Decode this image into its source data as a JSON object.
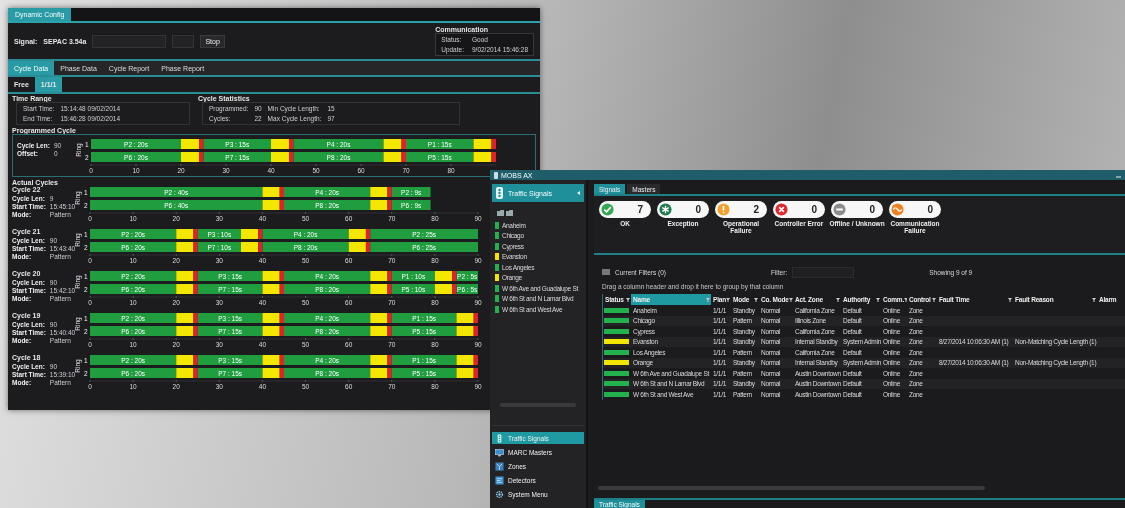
{
  "config_window": {
    "title": "Dynamic Config",
    "signal_label": "Signal:",
    "signal_value": "SEPAC 3.54a",
    "stop_button": "Stop",
    "communication": {
      "title": "Communication",
      "rows": [
        {
          "label": "Status:",
          "value": "Good"
        },
        {
          "label": "Update:",
          "value": "9/02/2014 15:46:28"
        }
      ]
    },
    "tabs": [
      {
        "label": "Cycle Data",
        "selected": true
      },
      {
        "label": "Phase Data",
        "selected": false
      },
      {
        "label": "Cycle Report",
        "selected": false
      },
      {
        "label": "Phase Report",
        "selected": false
      }
    ],
    "sub_tabs": [
      {
        "label": "Free",
        "selected": false
      },
      {
        "label": "1/1/1",
        "selected": true
      }
    ],
    "time_range": {
      "title": "Time Range",
      "rows": [
        {
          "label": "Start Time:",
          "value": "15:14:48 09/02/2014"
        },
        {
          "label": "End Time:",
          "value": "15:46:28 09/02/2014"
        }
      ]
    },
    "cycle_statistics": {
      "title": "Cycle Statistics",
      "items": [
        {
          "label": "Programmed:",
          "value": "90"
        },
        {
          "label": "Min Cycle Length:",
          "value": "15"
        },
        {
          "label": "Cycles:",
          "value": "22"
        },
        {
          "label": "Max Cycle Length:",
          "value": "97"
        }
      ]
    },
    "programmed_cycle": {
      "title": "Programmed Cycle",
      "fields": [
        {
          "label": "Cycle Len:",
          "value": "90"
        },
        {
          "label": "Offset:",
          "value": "0"
        }
      ],
      "chart_data": {
        "type": "bar",
        "orientation": "horizontal",
        "stacked": true,
        "ylabel": "Ring",
        "categories": [
          "1",
          "2"
        ],
        "xlim": [
          0,
          90
        ],
        "xticks": [
          0,
          10,
          20,
          30,
          40,
          50,
          60,
          70,
          80
        ],
        "series": [
          {
            "color": "#1f9d3f",
            "values": [
              20,
              20
            ],
            "value_labels": [
              "P2 : 20s",
              "P6 : 20s"
            ]
          },
          {
            "color": "#f3e600",
            "values": [
              4,
              4
            ]
          },
          {
            "color": "#e3202b",
            "values": [
              1,
              1
            ]
          },
          {
            "color": "#1f9d3f",
            "values": [
              15,
              15
            ],
            "value_labels": [
              "P3 : 15s",
              "P7 : 15s"
            ]
          },
          {
            "color": "#f3e600",
            "values": [
              4,
              4
            ]
          },
          {
            "color": "#e3202b",
            "values": [
              1,
              1
            ]
          },
          {
            "color": "#1f9d3f",
            "values": [
              20,
              20
            ],
            "value_labels": [
              "P4 : 20s",
              "P8 : 20s"
            ]
          },
          {
            "color": "#f3e600",
            "values": [
              4,
              4
            ]
          },
          {
            "color": "#e3202b",
            "values": [
              1,
              1
            ]
          },
          {
            "color": "#1f9d3f",
            "values": [
              15,
              15
            ],
            "value_labels": [
              "P1 : 15s",
              "P5 : 15s"
            ]
          },
          {
            "color": "#f3e600",
            "values": [
              4,
              4
            ]
          },
          {
            "color": "#e3202b",
            "values": [
              1,
              1
            ]
          }
        ]
      }
    },
    "actual_cycles": {
      "title": "Actual Cycles",
      "cycles": [
        {
          "title": "Cycle 22",
          "fields": [
            {
              "label": "Cycle Len:",
              "value": "9"
            },
            {
              "label": "Start Time:",
              "value": "15:45:10"
            },
            {
              "label": "Mode:",
              "value": "Pattern"
            }
          ],
          "chart_data": {
            "type": "bar",
            "orientation": "horizontal",
            "stacked": true,
            "ylabel": "Ring",
            "categories": [
              "1",
              "2"
            ],
            "xlim": [
              0,
              90
            ],
            "xticks": [
              0,
              10,
              20,
              30,
              40,
              50,
              60,
              70,
              80,
              90
            ],
            "series": [
              {
                "color": "#1f9d3f",
                "values": [
                  40,
                  40
                ],
                "value_labels": [
                  "P2 : 40s",
                  "P6 : 40s"
                ]
              },
              {
                "color": "#f3e600",
                "values": [
                  4,
                  4
                ]
              },
              {
                "color": "#e3202b",
                "values": [
                  1,
                  1
                ]
              },
              {
                "color": "#1f9d3f",
                "values": [
                  20,
                  20
                ],
                "value_labels": [
                  "P4 : 20s",
                  "P8 : 20s"
                ]
              },
              {
                "color": "#f3e600",
                "values": [
                  4,
                  4
                ]
              },
              {
                "color": "#e3202b",
                "values": [
                  1,
                  1
                ]
              },
              {
                "color": "#1f9d3f",
                "values": [
                  9,
                  9
                ],
                "value_labels": [
                  "P2 : 9s",
                  "P6 : 9s"
                ]
              }
            ]
          }
        },
        {
          "title": "Cycle 21",
          "fields": [
            {
              "label": "Cycle Len:",
              "value": "90"
            },
            {
              "label": "Start Time:",
              "value": "15:43:40"
            },
            {
              "label": "Mode:",
              "value": "Pattern"
            }
          ],
          "chart_data": {
            "type": "bar",
            "orientation": "horizontal",
            "stacked": true,
            "ylabel": "Ring",
            "categories": [
              "1",
              "2"
            ],
            "xlim": [
              0,
              90
            ],
            "xticks": [
              0,
              10,
              20,
              30,
              40,
              50,
              60,
              70,
              80,
              90
            ],
            "series": [
              {
                "color": "#1f9d3f",
                "values": [
                  20,
                  20
                ],
                "value_labels": [
                  "P2 : 20s",
                  "P6 : 20s"
                ]
              },
              {
                "color": "#f3e600",
                "values": [
                  4,
                  4
                ]
              },
              {
                "color": "#e3202b",
                "values": [
                  1,
                  1
                ]
              },
              {
                "color": "#1f9d3f",
                "values": [
                  10,
                  10
                ],
                "value_labels": [
                  "P3 : 10s",
                  "P7 : 10s"
                ]
              },
              {
                "color": "#f3e600",
                "values": [
                  4,
                  4
                ]
              },
              {
                "color": "#e3202b",
                "values": [
                  1,
                  1
                ]
              },
              {
                "color": "#1f9d3f",
                "values": [
                  20,
                  20
                ],
                "value_labels": [
                  "P4 : 20s",
                  "P8 : 20s"
                ]
              },
              {
                "color": "#f3e600",
                "values": [
                  4,
                  4
                ]
              },
              {
                "color": "#e3202b",
                "values": [
                  1,
                  1
                ]
              },
              {
                "color": "#1f9d3f",
                "values": [
                  25,
                  25
                ],
                "value_labels": [
                  "P2 : 25s",
                  "P6 : 25s"
                ]
              }
            ]
          }
        },
        {
          "title": "Cycle 20",
          "fields": [
            {
              "label": "Cycle Len:",
              "value": "90"
            },
            {
              "label": "Start Time:",
              "value": "15:42:10"
            },
            {
              "label": "Mode:",
              "value": "Pattern"
            }
          ],
          "chart_data": {
            "type": "bar",
            "orientation": "horizontal",
            "stacked": true,
            "ylabel": "Ring",
            "categories": [
              "1",
              "2"
            ],
            "xlim": [
              0,
              90
            ],
            "xticks": [
              0,
              10,
              20,
              30,
              40,
              50,
              60,
              70,
              80,
              90
            ],
            "series": [
              {
                "color": "#1f9d3f",
                "values": [
                  20,
                  20
                ],
                "value_labels": [
                  "P2 : 20s",
                  "P6 : 20s"
                ]
              },
              {
                "color": "#f3e600",
                "values": [
                  4,
                  4
                ]
              },
              {
                "color": "#e3202b",
                "values": [
                  1,
                  1
                ]
              },
              {
                "color": "#1f9d3f",
                "values": [
                  15,
                  15
                ],
                "value_labels": [
                  "P3 : 15s",
                  "P7 : 15s"
                ]
              },
              {
                "color": "#f3e600",
                "values": [
                  4,
                  4
                ]
              },
              {
                "color": "#e3202b",
                "values": [
                  1,
                  1
                ]
              },
              {
                "color": "#1f9d3f",
                "values": [
                  20,
                  20
                ],
                "value_labels": [
                  "P4 : 20s",
                  "P8 : 20s"
                ]
              },
              {
                "color": "#f3e600",
                "values": [
                  4,
                  4
                ]
              },
              {
                "color": "#e3202b",
                "values": [
                  1,
                  1
                ]
              },
              {
                "color": "#1f9d3f",
                "values": [
                  10,
                  10
                ],
                "value_labels": [
                  "P1 : 10s",
                  "P5 : 10s"
                ]
              },
              {
                "color": "#f3e600",
                "values": [
                  4,
                  4
                ]
              },
              {
                "color": "#e3202b",
                "values": [
                  1,
                  1
                ]
              },
              {
                "color": "#1f9d3f",
                "values": [
                  5,
                  5
                ],
                "value_labels": [
                  "P2 : 5s",
                  "P6 : 5s"
                ]
              }
            ]
          }
        },
        {
          "title": "Cycle 19",
          "fields": [
            {
              "label": "Cycle Len:",
              "value": "90"
            },
            {
              "label": "Start Time:",
              "value": "15:40:40"
            },
            {
              "label": "Mode:",
              "value": "Pattern"
            }
          ],
          "chart_data": {
            "type": "bar",
            "orientation": "horizontal",
            "stacked": true,
            "ylabel": "Ring",
            "categories": [
              "1",
              "2"
            ],
            "xlim": [
              0,
              90
            ],
            "xticks": [
              0,
              10,
              20,
              30,
              40,
              50,
              60,
              70,
              80,
              90
            ],
            "series": [
              {
                "color": "#1f9d3f",
                "values": [
                  20,
                  20
                ],
                "value_labels": [
                  "P2 : 20s",
                  "P6 : 20s"
                ]
              },
              {
                "color": "#f3e600",
                "values": [
                  4,
                  4
                ]
              },
              {
                "color": "#e3202b",
                "values": [
                  1,
                  1
                ]
              },
              {
                "color": "#1f9d3f",
                "values": [
                  15,
                  15
                ],
                "value_labels": [
                  "P3 : 15s",
                  "P7 : 15s"
                ]
              },
              {
                "color": "#f3e600",
                "values": [
                  4,
                  4
                ]
              },
              {
                "color": "#e3202b",
                "values": [
                  1,
                  1
                ]
              },
              {
                "color": "#1f9d3f",
                "values": [
                  20,
                  20
                ],
                "value_labels": [
                  "P4 : 20s",
                  "P8 : 20s"
                ]
              },
              {
                "color": "#f3e600",
                "values": [
                  4,
                  4
                ]
              },
              {
                "color": "#e3202b",
                "values": [
                  1,
                  1
                ]
              },
              {
                "color": "#1f9d3f",
                "values": [
                  15,
                  15
                ],
                "value_labels": [
                  "P1 : 15s",
                  "P5 : 15s"
                ]
              },
              {
                "color": "#f3e600",
                "values": [
                  4,
                  4
                ]
              },
              {
                "color": "#e3202b",
                "values": [
                  1,
                  1
                ]
              }
            ]
          }
        },
        {
          "title": "Cycle 18",
          "fields": [
            {
              "label": "Cycle Len:",
              "value": "90"
            },
            {
              "label": "Start Time:",
              "value": "15:39:10"
            },
            {
              "label": "Mode:",
              "value": "Pattern"
            }
          ],
          "chart_data": {
            "type": "bar",
            "orientation": "horizontal",
            "stacked": true,
            "ylabel": "Ring",
            "categories": [
              "1",
              "2"
            ],
            "xlim": [
              0,
              90
            ],
            "xticks": [
              0,
              10,
              20,
              30,
              40,
              50,
              60,
              70,
              80,
              90
            ],
            "series": [
              {
                "color": "#1f9d3f",
                "values": [
                  20,
                  20
                ],
                "value_labels": [
                  "P2 : 20s",
                  "P6 : 20s"
                ]
              },
              {
                "color": "#f3e600",
                "values": [
                  4,
                  4
                ]
              },
              {
                "color": "#e3202b",
                "values": [
                  1,
                  1
                ]
              },
              {
                "color": "#1f9d3f",
                "values": [
                  15,
                  15
                ],
                "value_labels": [
                  "P3 : 15s",
                  "P7 : 15s"
                ]
              },
              {
                "color": "#f3e600",
                "values": [
                  4,
                  4
                ]
              },
              {
                "color": "#e3202b",
                "values": [
                  1,
                  1
                ]
              },
              {
                "color": "#1f9d3f",
                "values": [
                  20,
                  20
                ],
                "value_labels": [
                  "P4 : 20s",
                  "P8 : 20s"
                ]
              },
              {
                "color": "#f3e600",
                "values": [
                  4,
                  4
                ]
              },
              {
                "color": "#e3202b",
                "values": [
                  1,
                  1
                ]
              },
              {
                "color": "#1f9d3f",
                "values": [
                  15,
                  15
                ],
                "value_labels": [
                  "P1 : 15s",
                  "P5 : 15s"
                ]
              },
              {
                "color": "#f3e600",
                "values": [
                  4,
                  4
                ]
              },
              {
                "color": "#e3202b",
                "values": [
                  1,
                  1
                ]
              }
            ]
          }
        }
      ]
    }
  },
  "mobs_window": {
    "title": "MOBS AX",
    "sidebar": {
      "header": "Traffic Signals",
      "sites": [
        {
          "name": "Anaheim",
          "color": "#22b14c"
        },
        {
          "name": "Chicago",
          "color": "#22b14c"
        },
        {
          "name": "Cypress",
          "color": "#22b14c"
        },
        {
          "name": "Evanston",
          "color": "#f2e600"
        },
        {
          "name": "Los Angeles",
          "color": "#22b14c"
        },
        {
          "name": "Orange",
          "color": "#f2e600"
        },
        {
          "name": "W 6th Ave and Guadalupe St",
          "color": "#22b14c"
        },
        {
          "name": "W 6th St and N Lamar Blvd",
          "color": "#22b14c"
        },
        {
          "name": "W 6th St and West Ave",
          "color": "#22b14c"
        }
      ],
      "nav": [
        {
          "kind": "signal",
          "label": "Traffic Signals",
          "selected": true
        },
        {
          "kind": "monitor",
          "label": "MARC Masters",
          "selected": false
        },
        {
          "kind": "map",
          "label": "Zones",
          "selected": false
        },
        {
          "kind": "detector",
          "label": "Detectors",
          "selected": false
        },
        {
          "kind": "gear",
          "label": "System Menu",
          "selected": false
        }
      ]
    },
    "tabs": [
      {
        "label": "Signals",
        "selected": true
      },
      {
        "label": "Masters",
        "selected": false
      }
    ],
    "status_cards": [
      {
        "kind": "ok",
        "color": "#33a852",
        "count": "7",
        "label": "OK"
      },
      {
        "kind": "exception",
        "color": "#1d7a4c",
        "count": "0",
        "label": "Exception"
      },
      {
        "kind": "warning",
        "color": "#f2a22b",
        "count": "2",
        "label": "Operational Failure"
      },
      {
        "kind": "error",
        "color": "#e3262d",
        "count": "0",
        "label": "Controller Error"
      },
      {
        "kind": "offline",
        "color": "#8c8c8c",
        "count": "0",
        "label": "Offline / Unknown"
      },
      {
        "kind": "comm",
        "color": "#f2801f",
        "count": "0",
        "label": "Communication Failure"
      }
    ],
    "filters": {
      "current": "Current Filters (0)",
      "filter_label": "Filter:",
      "showing": "Showing 9 of 9"
    },
    "group_hint": "Drag a column header and drop it here to group by that column",
    "table": {
      "columns": [
        {
          "label": "Status",
          "sorted": false
        },
        {
          "label": "Name",
          "sorted": true
        },
        {
          "label": "Plan",
          "sorted": false
        },
        {
          "label": "Mode",
          "sorted": false
        },
        {
          "label": "Co. Mode",
          "sorted": false
        },
        {
          "label": "Act. Zone",
          "sorted": false
        },
        {
          "label": "Authority",
          "sorted": false
        },
        {
          "label": "Comm.",
          "sorted": false
        },
        {
          "label": "Control",
          "sorted": false
        },
        {
          "label": "Fault Time",
          "sorted": false
        },
        {
          "label": "Fault Reason",
          "sorted": false
        },
        {
          "label": "Alarm",
          "sorted": false
        }
      ],
      "rows": [
        {
          "color": "#22b14c",
          "cells": [
            "",
            "Anaheim",
            "1/1/1",
            "Standby",
            "Normal",
            "California Zone",
            "Default",
            "Online",
            "Zone"
          ]
        },
        {
          "color": "#22b14c",
          "cells": [
            "",
            "Chicago",
            "1/1/1",
            "Pattern",
            "Normal",
            "Illinois Zone",
            "Default",
            "Online",
            "Zone"
          ]
        },
        {
          "color": "#22b14c",
          "cells": [
            "",
            "Cypress",
            "1/1/1",
            "Standby",
            "Normal",
            "California Zone",
            "Default",
            "Online",
            "Zone"
          ]
        },
        {
          "color": "#f2e600",
          "cells": [
            "",
            "Evanston",
            "1/1/1",
            "Standby",
            "Normal",
            "Internal Standby",
            "System Admin",
            "Online",
            "Zone",
            "8/27/2014 10:06:30 AM (1)",
            "Non-Matching Cycle Length (1)"
          ]
        },
        {
          "color": "#22b14c",
          "cells": [
            "",
            "Los Angeles",
            "1/1/1",
            "Pattern",
            "Normal",
            "California Zone",
            "Default",
            "Online",
            "Zone"
          ]
        },
        {
          "color": "#f2e600",
          "cells": [
            "",
            "Orange",
            "1/1/1",
            "Standby",
            "Normal",
            "Internal Standby",
            "System Admin",
            "Online",
            "Zone",
            "8/27/2014 10:06:30 AM (1)",
            "Non-Matching Cycle Length (1)"
          ]
        },
        {
          "color": "#22b14c",
          "cells": [
            "",
            "W 6th Ave and Guadalupe St",
            "1/1/1",
            "Pattern",
            "Normal",
            "Austin Downtown",
            "Default",
            "Online",
            "Zone"
          ]
        },
        {
          "color": "#22b14c",
          "cells": [
            "",
            "W 6th St and N Lamar Blvd",
            "1/1/1",
            "Standby",
            "Normal",
            "Austin Downtown",
            "Default",
            "Online",
            "Zone"
          ]
        },
        {
          "color": "#22b14c",
          "cells": [
            "",
            "W 6th St and West Ave",
            "1/1/1",
            "Pattern",
            "Normal",
            "Austin Downtown",
            "Default",
            "Online",
            "Zone"
          ]
        }
      ]
    },
    "bottom_tab": "Traffic Signals"
  }
}
